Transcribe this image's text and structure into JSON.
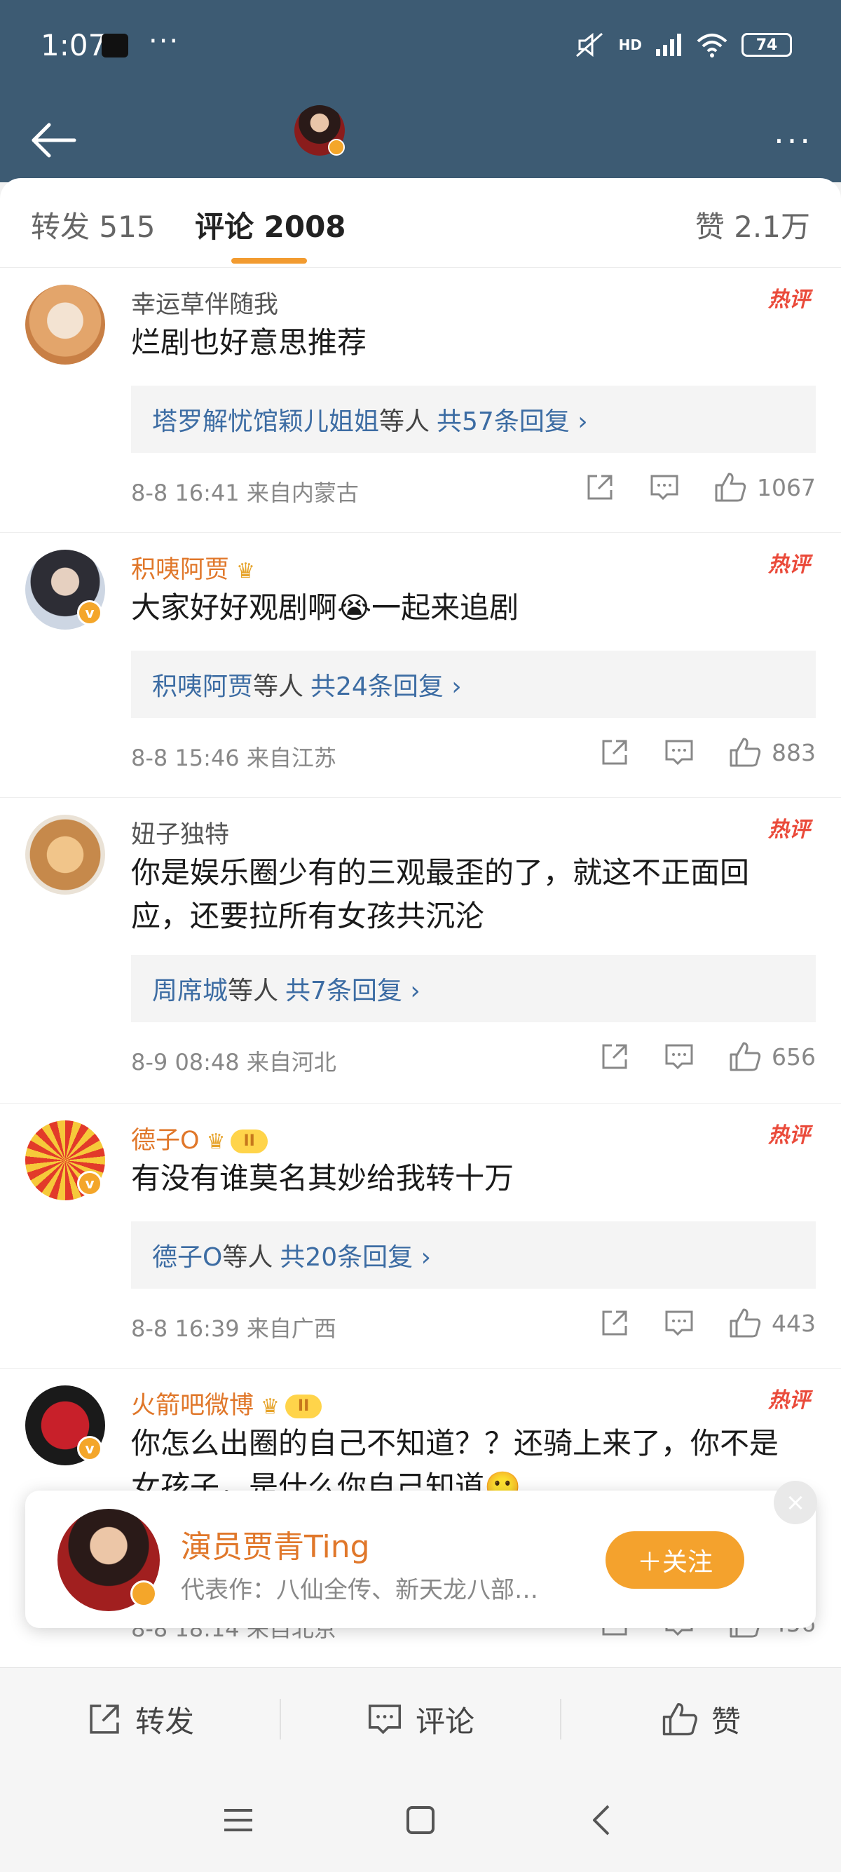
{
  "status_bar": {
    "time": "1:07",
    "dots": "···",
    "network": "HD",
    "battery": "74"
  },
  "header": {
    "more": "···"
  },
  "tabs": [
    {
      "label": "转发 515"
    },
    {
      "label": "评论 2008"
    },
    {
      "label": "赞 2.1万"
    }
  ],
  "hot_label": "热评",
  "comments": [
    {
      "username": "幸运草伴随我",
      "text": "烂剧也好意思推荐",
      "replies_who": "塔罗解忧馆颖儿姐姐",
      "replies_tail": "等人",
      "replies_count": "共57条回复 ›",
      "meta": "8-8 16:41 来自内蒙古",
      "likes": "1067"
    },
    {
      "username": "积咦阿贾",
      "text": "大家好好观剧啊😭一起来追剧",
      "replies_who": "积咦阿贾",
      "replies_tail": "等人",
      "replies_count": "共24条回复 ›",
      "meta": "8-8 15:46 来自江苏",
      "likes": "883"
    },
    {
      "username": "妞子独特",
      "text": "你是娱乐圈少有的三观最歪的了，就这不正面回应，还要拉所有女孩共沉沦",
      "replies_who": "周席城",
      "replies_tail": "等人",
      "replies_count": "共7条回复 ›",
      "meta": "8-9 08:48 来自河北",
      "likes": "656"
    },
    {
      "username": "德子O",
      "level": "II",
      "text": "有没有谁莫名其妙给我转十万",
      "replies_who": "德子O",
      "replies_tail": "等人",
      "replies_count": "共20条回复 ›",
      "meta": "8-8 16:39 来自广西",
      "likes": "443"
    },
    {
      "username": "火箭吧微博",
      "level": "II",
      "text": "你怎么出圈的自己不知道？？还骑上来了，你不是女孩子，是什么你自己知道🙂",
      "meta": "8-8 18:14 来自北京",
      "likes": "456"
    }
  ],
  "follow_popup": {
    "name": "演员贾青Ting",
    "works": "代表作：八仙全传、新天龙八部…",
    "follow_label": "＋关注",
    "close": "×"
  },
  "bottom_bar": {
    "repost": "转发",
    "comment": "评论",
    "like": "赞"
  },
  "colors": {
    "header_bg": "#3d5b73",
    "accent_orange": "#f29b30",
    "link_blue": "#3c6ca3",
    "hot_red": "#ea4a3a"
  }
}
